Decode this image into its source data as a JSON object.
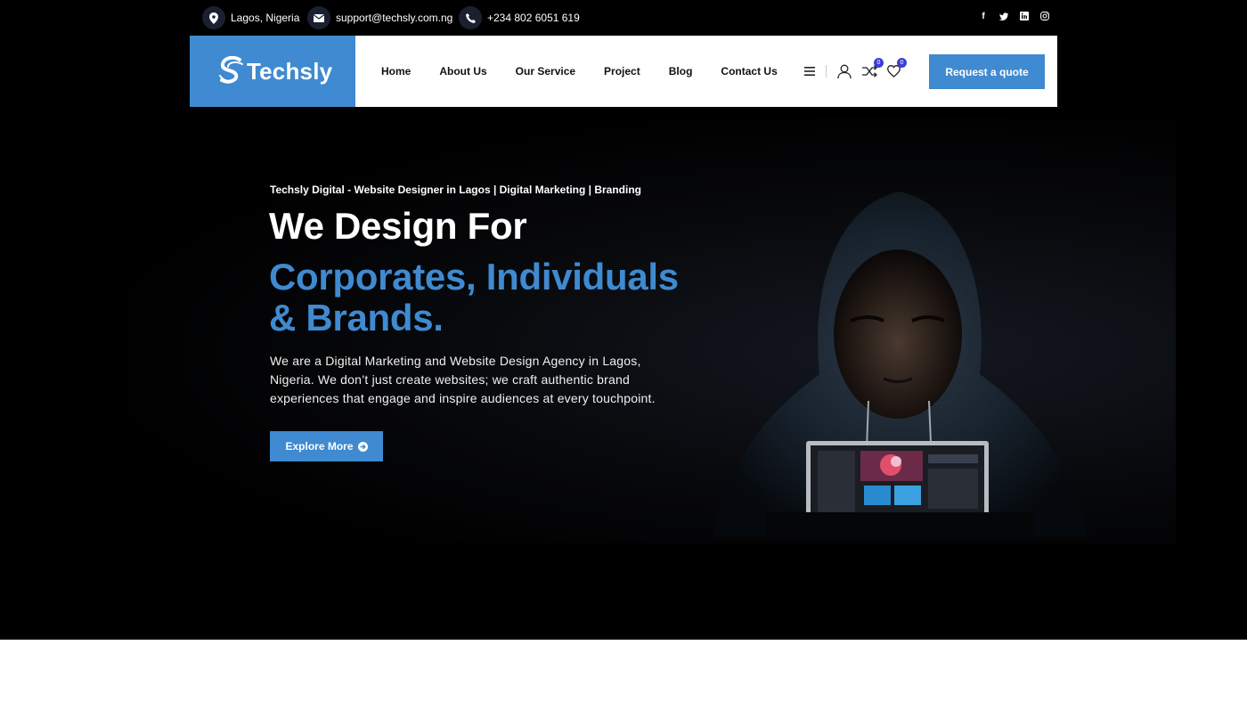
{
  "topbar": {
    "location": "Lagos, Nigeria",
    "email": "support@techsly.com.ng",
    "phone": "+234 802 6051 619",
    "socials": [
      "facebook-icon",
      "twitter-icon",
      "linkedin-icon",
      "instagram-icon"
    ]
  },
  "header": {
    "logo_text": "Techsly",
    "nav": [
      "Home",
      "About Us",
      "Our Service",
      "Project",
      "Blog",
      "Contact Us"
    ],
    "compare_count": "0",
    "wishlist_count": "0",
    "quote_label": "Request a quote"
  },
  "hero": {
    "tagline": "Techsly Digital - Website Designer in Lagos | Digital Marketing | Branding",
    "title": "We Design For",
    "subtitle": "Corporates, Individuals & Brands.",
    "description": "We are a Digital Marketing and Website Design Agency in Lagos, Nigeria. We don’t just create websites; we craft authentic brand experiences that engage and inspire audiences at every touchpoint.",
    "cta_label": "Explore More"
  },
  "colors": {
    "accent": "#3f8ad0",
    "badge": "#3c3fd0",
    "hero_bg": "#000000"
  }
}
